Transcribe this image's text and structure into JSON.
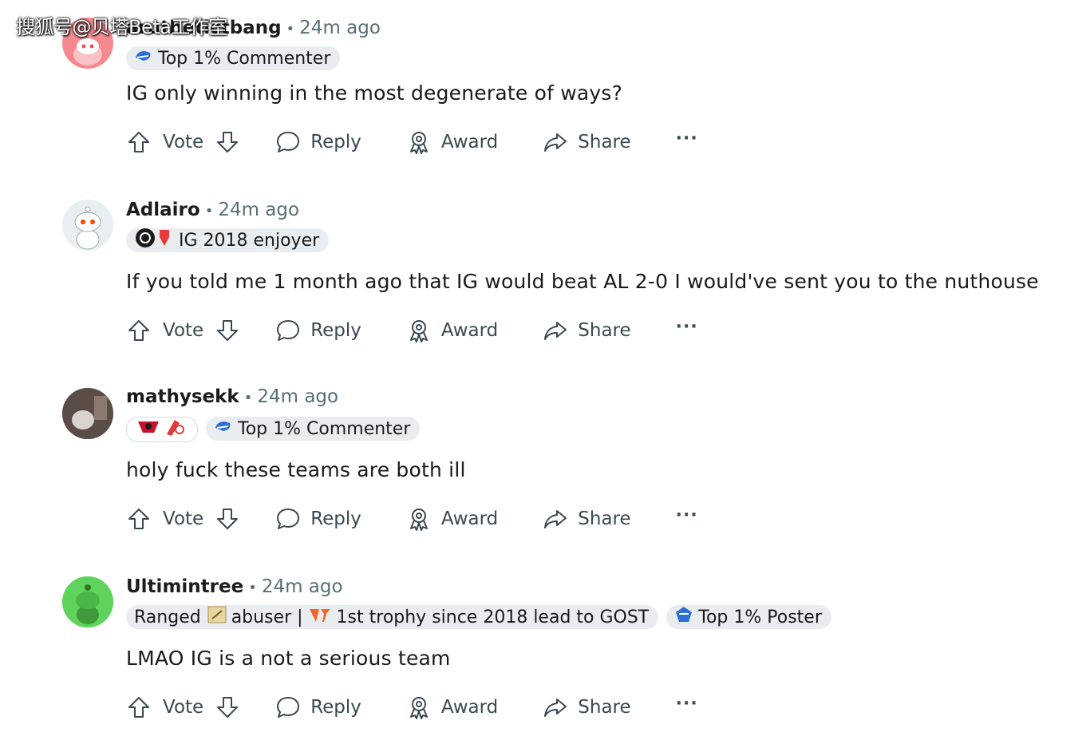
{
  "watermark": "搜狐号@贝塔Beta工作室",
  "actions": {
    "vote": "Vote",
    "reply": "Reply",
    "award": "Award",
    "share": "Share",
    "more": "···"
  },
  "comments": [
    {
      "username": "aruthetictbang",
      "time": "24m ago",
      "flairs": [
        "Top 1% Commenter"
      ],
      "text": "IG only winning in the most degenerate of ways?",
      "avatar_color": "#f48a8f"
    },
    {
      "username": "Adlairo",
      "time": "24m ago",
      "flairs": [
        "IG 2018 enjoyer"
      ],
      "text": "If you told me 1 month ago that IG would beat AL 2-0 I would've sent you to the nuthouse",
      "avatar_color": "#e9eef1"
    },
    {
      "username": "mathysekk",
      "time": "24m ago",
      "flairs": [
        "",
        "Top 1% Commenter"
      ],
      "text": "holy fuck these teams are both ill",
      "avatar_color": "#4a3f3c"
    },
    {
      "username": "Ultimintree",
      "time": "24m ago",
      "flairs": [
        "Ranged",
        "abuser |",
        "1st trophy since 2018 lead to GOST",
        "Top 1% Poster"
      ],
      "text": "LMAO IG is a not a serious team",
      "avatar_color": "#5fd35b"
    }
  ]
}
